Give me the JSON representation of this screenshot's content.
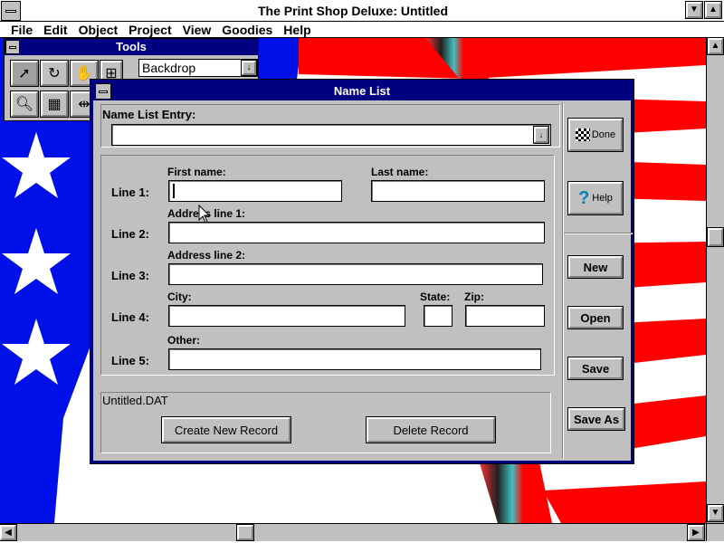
{
  "window": {
    "title": "The Print Shop Deluxe: Untitled"
  },
  "menu": [
    "File",
    "Edit",
    "Object",
    "Project",
    "View",
    "Goodies",
    "Help"
  ],
  "tools": {
    "title": "Tools",
    "backdrop_value": "Backdrop"
  },
  "dialog": {
    "title": "Name List",
    "name_list_entry_label": "Name List Entry:",
    "line_labels": [
      "Line 1:",
      "Line 2:",
      "Line 3:",
      "Line 4:",
      "Line 5:"
    ],
    "fields": {
      "first_name": "First name:",
      "last_name": "Last name:",
      "address1": "Address line 1:",
      "address2": "Address line 2:",
      "city": "City:",
      "state": "State:",
      "zip": "Zip:",
      "other": "Other:"
    },
    "filename": "Untitled.DAT",
    "buttons": {
      "create": "Create New Record",
      "delete": "Delete Record",
      "done": "Done",
      "help": "Help",
      "new": "New",
      "open": "Open",
      "save": "Save",
      "save_as": "Save As"
    }
  },
  "colors": {
    "title_bar": "#000080",
    "flag_blue": "#0000e0",
    "flag_red": "#ff0000",
    "dialog_face": "#c0c0c0"
  }
}
